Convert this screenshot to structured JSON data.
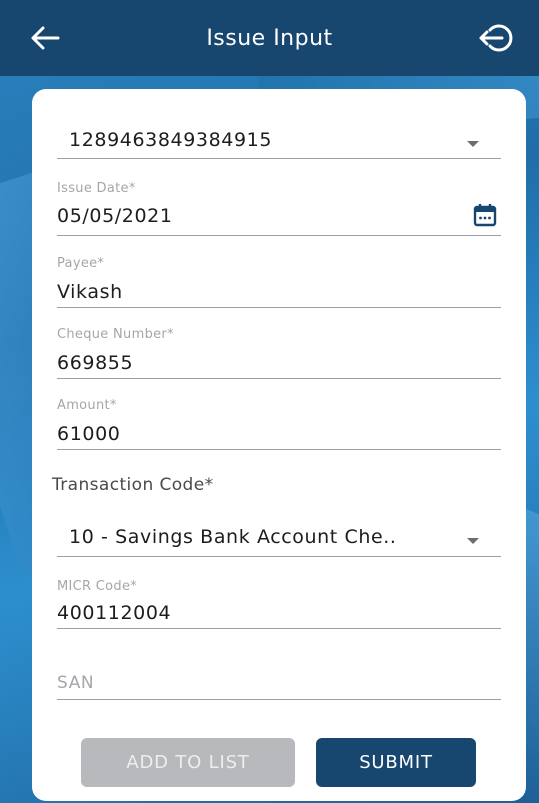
{
  "header": {
    "title": "Issue Input",
    "back_icon": "arrow-left-icon",
    "logout_icon": "logout-icon"
  },
  "form": {
    "account": {
      "value": "1289463849384915"
    },
    "issue_date": {
      "label": "Issue Date*",
      "value": "05/05/2021",
      "icon": "calendar-icon"
    },
    "payee": {
      "label": "Payee*",
      "value": "Vikash"
    },
    "cheque_number": {
      "label": "Cheque Number*",
      "value": "669855"
    },
    "amount": {
      "label": "Amount*",
      "value": "61000"
    },
    "transaction_code": {
      "section_label": "Transaction Code*",
      "value": "10 - Savings Bank Account Che.."
    },
    "micr_code": {
      "label": "MICR Code*",
      "value": "400112004"
    },
    "san": {
      "placeholder": "SAN"
    }
  },
  "buttons": {
    "add_to_list": "ADD TO LIST",
    "submit": "SUBMIT"
  },
  "colors": {
    "primary": "#17466f",
    "disabled_button": "#b7b9bc",
    "background_blue": "#2b83c0"
  }
}
